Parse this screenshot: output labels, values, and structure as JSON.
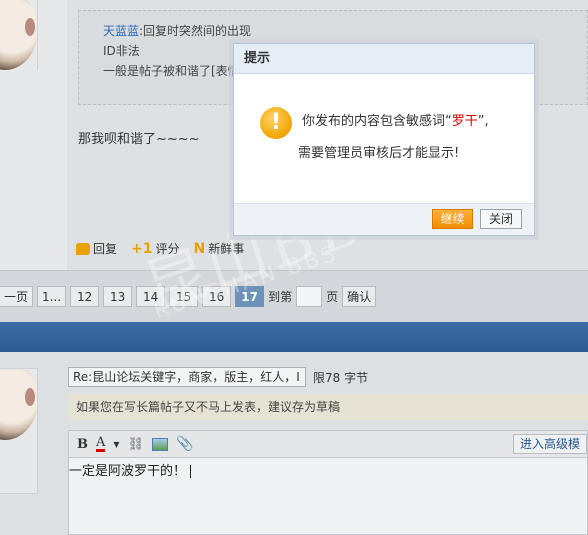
{
  "quote": {
    "name": "天蓝蓝",
    "line1_rest": ":回复时突然间的出现",
    "line2": "ID非法",
    "line3": "一般是帖子被和谐了[表情"
  },
  "post": {
    "reply_text": "那我呗和谐了~~~~"
  },
  "actions": {
    "reply": "回复",
    "rate": "评分",
    "news": "新鲜事"
  },
  "pager": {
    "prev": "一页",
    "ellipsis": "1...",
    "pages": [
      "12",
      "13",
      "14",
      "15",
      "16"
    ],
    "current": "17",
    "goto_label": "到第",
    "page_unit": "页",
    "confirm": "确认"
  },
  "composer": {
    "subject_value": "Re:昆山论坛关键字，商家，版主，红人，Ⅰ",
    "limit_text": "限78 字节",
    "draft_notice": "如果您在写长篇帖子又不马上发表，建议存为草稿",
    "advanced_mode": "进入高级模",
    "editor_text": "一定是阿波罗干的！"
  },
  "watermark": {
    "main": "昆山BBS",
    "sub": "KUNSHAN BBS"
  },
  "dialog": {
    "title": "提示",
    "message_prefix": "你发布的内容包含敏感词“",
    "keyword": "罗干",
    "message_suffix": "”,",
    "message_line2": "需要管理员审核后才能显示!",
    "continue_label": "继续",
    "close_label": "关闭",
    "warning_icon": "!"
  },
  "colors": {
    "accent_orange": "#f08c00",
    "keyword_red": "#d40000",
    "link_blue": "#2a68b3",
    "header_blue": "#2b5a92"
  }
}
